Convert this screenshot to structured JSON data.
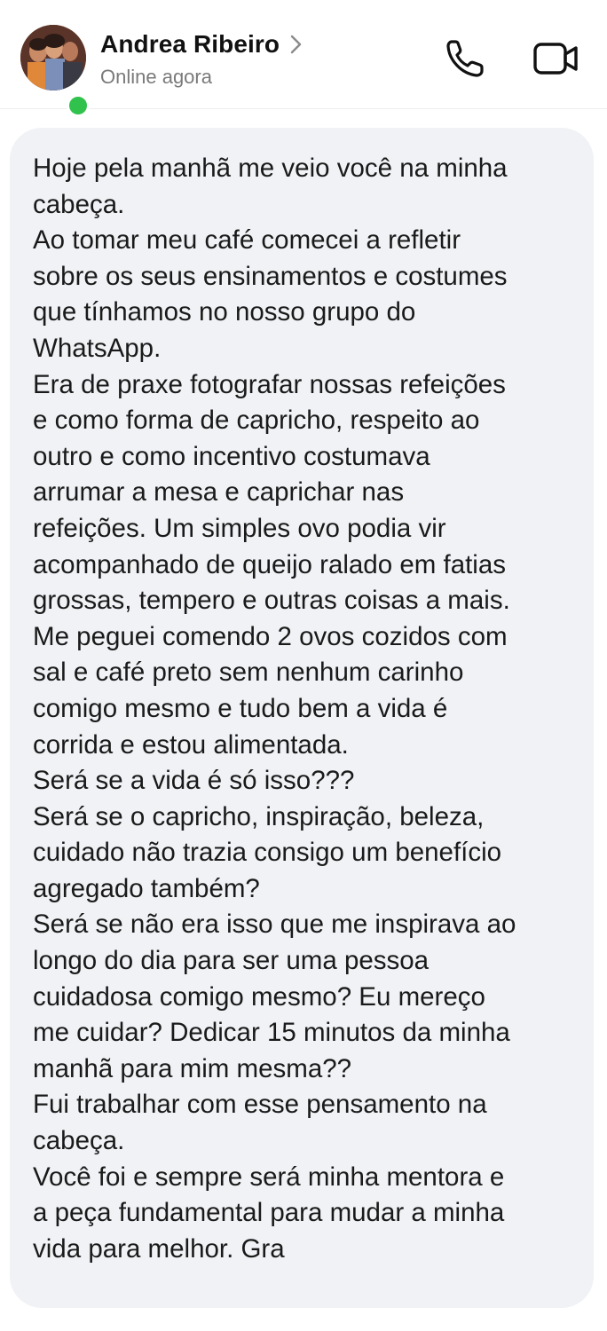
{
  "header": {
    "contact_name": "Andrea Ribeiro",
    "status": "Online agora",
    "icons": {
      "chevron": "chevron-right-icon",
      "call": "phone-icon",
      "video": "video-camera-icon"
    },
    "colors": {
      "online": "#31c24d",
      "icon": "#111111",
      "status_text": "#7a7a7a"
    }
  },
  "message": {
    "bubble_color": "#f0f2f5",
    "lines": [
      "Hoje pela manhã me veio você na minha",
      "cabeça.",
      "Ao tomar meu café comecei a refletir",
      "sobre os seus ensinamentos e costumes",
      "que tínhamos no nosso grupo do",
      "WhatsApp.",
      "Era de praxe fotografar nossas refeições",
      "e como forma de capricho, respeito ao",
      "outro e como incentivo costumava",
      "arrumar a mesa e caprichar nas",
      "refeições. Um simples ovo podia vir",
      "acompanhado de queijo ralado em fatias",
      "grossas, tempero e outras coisas a mais.",
      "Me peguei comendo 2 ovos cozidos com",
      "sal e café preto sem nenhum carinho",
      "comigo mesmo e tudo bem a vida é",
      "corrida e estou alimentada.",
      "Será se a vida é só isso???",
      "Será se o capricho, inspiração, beleza,",
      "cuidado não trazia consigo um benefício",
      "agregado também?",
      "Será se não era isso que me inspirava ao",
      "longo do dia para ser uma pessoa",
      "cuidadosa comigo mesmo? Eu mereço",
      "me cuidar? Dedicar 15 minutos da minha",
      "manhã para mim mesma??",
      "Fui trabalhar com esse pensamento na",
      "cabeça.",
      "Você foi e sempre será minha mentora e",
      "a peça  fundamental para mudar a minha",
      "vida para melhor. Gra"
    ]
  }
}
